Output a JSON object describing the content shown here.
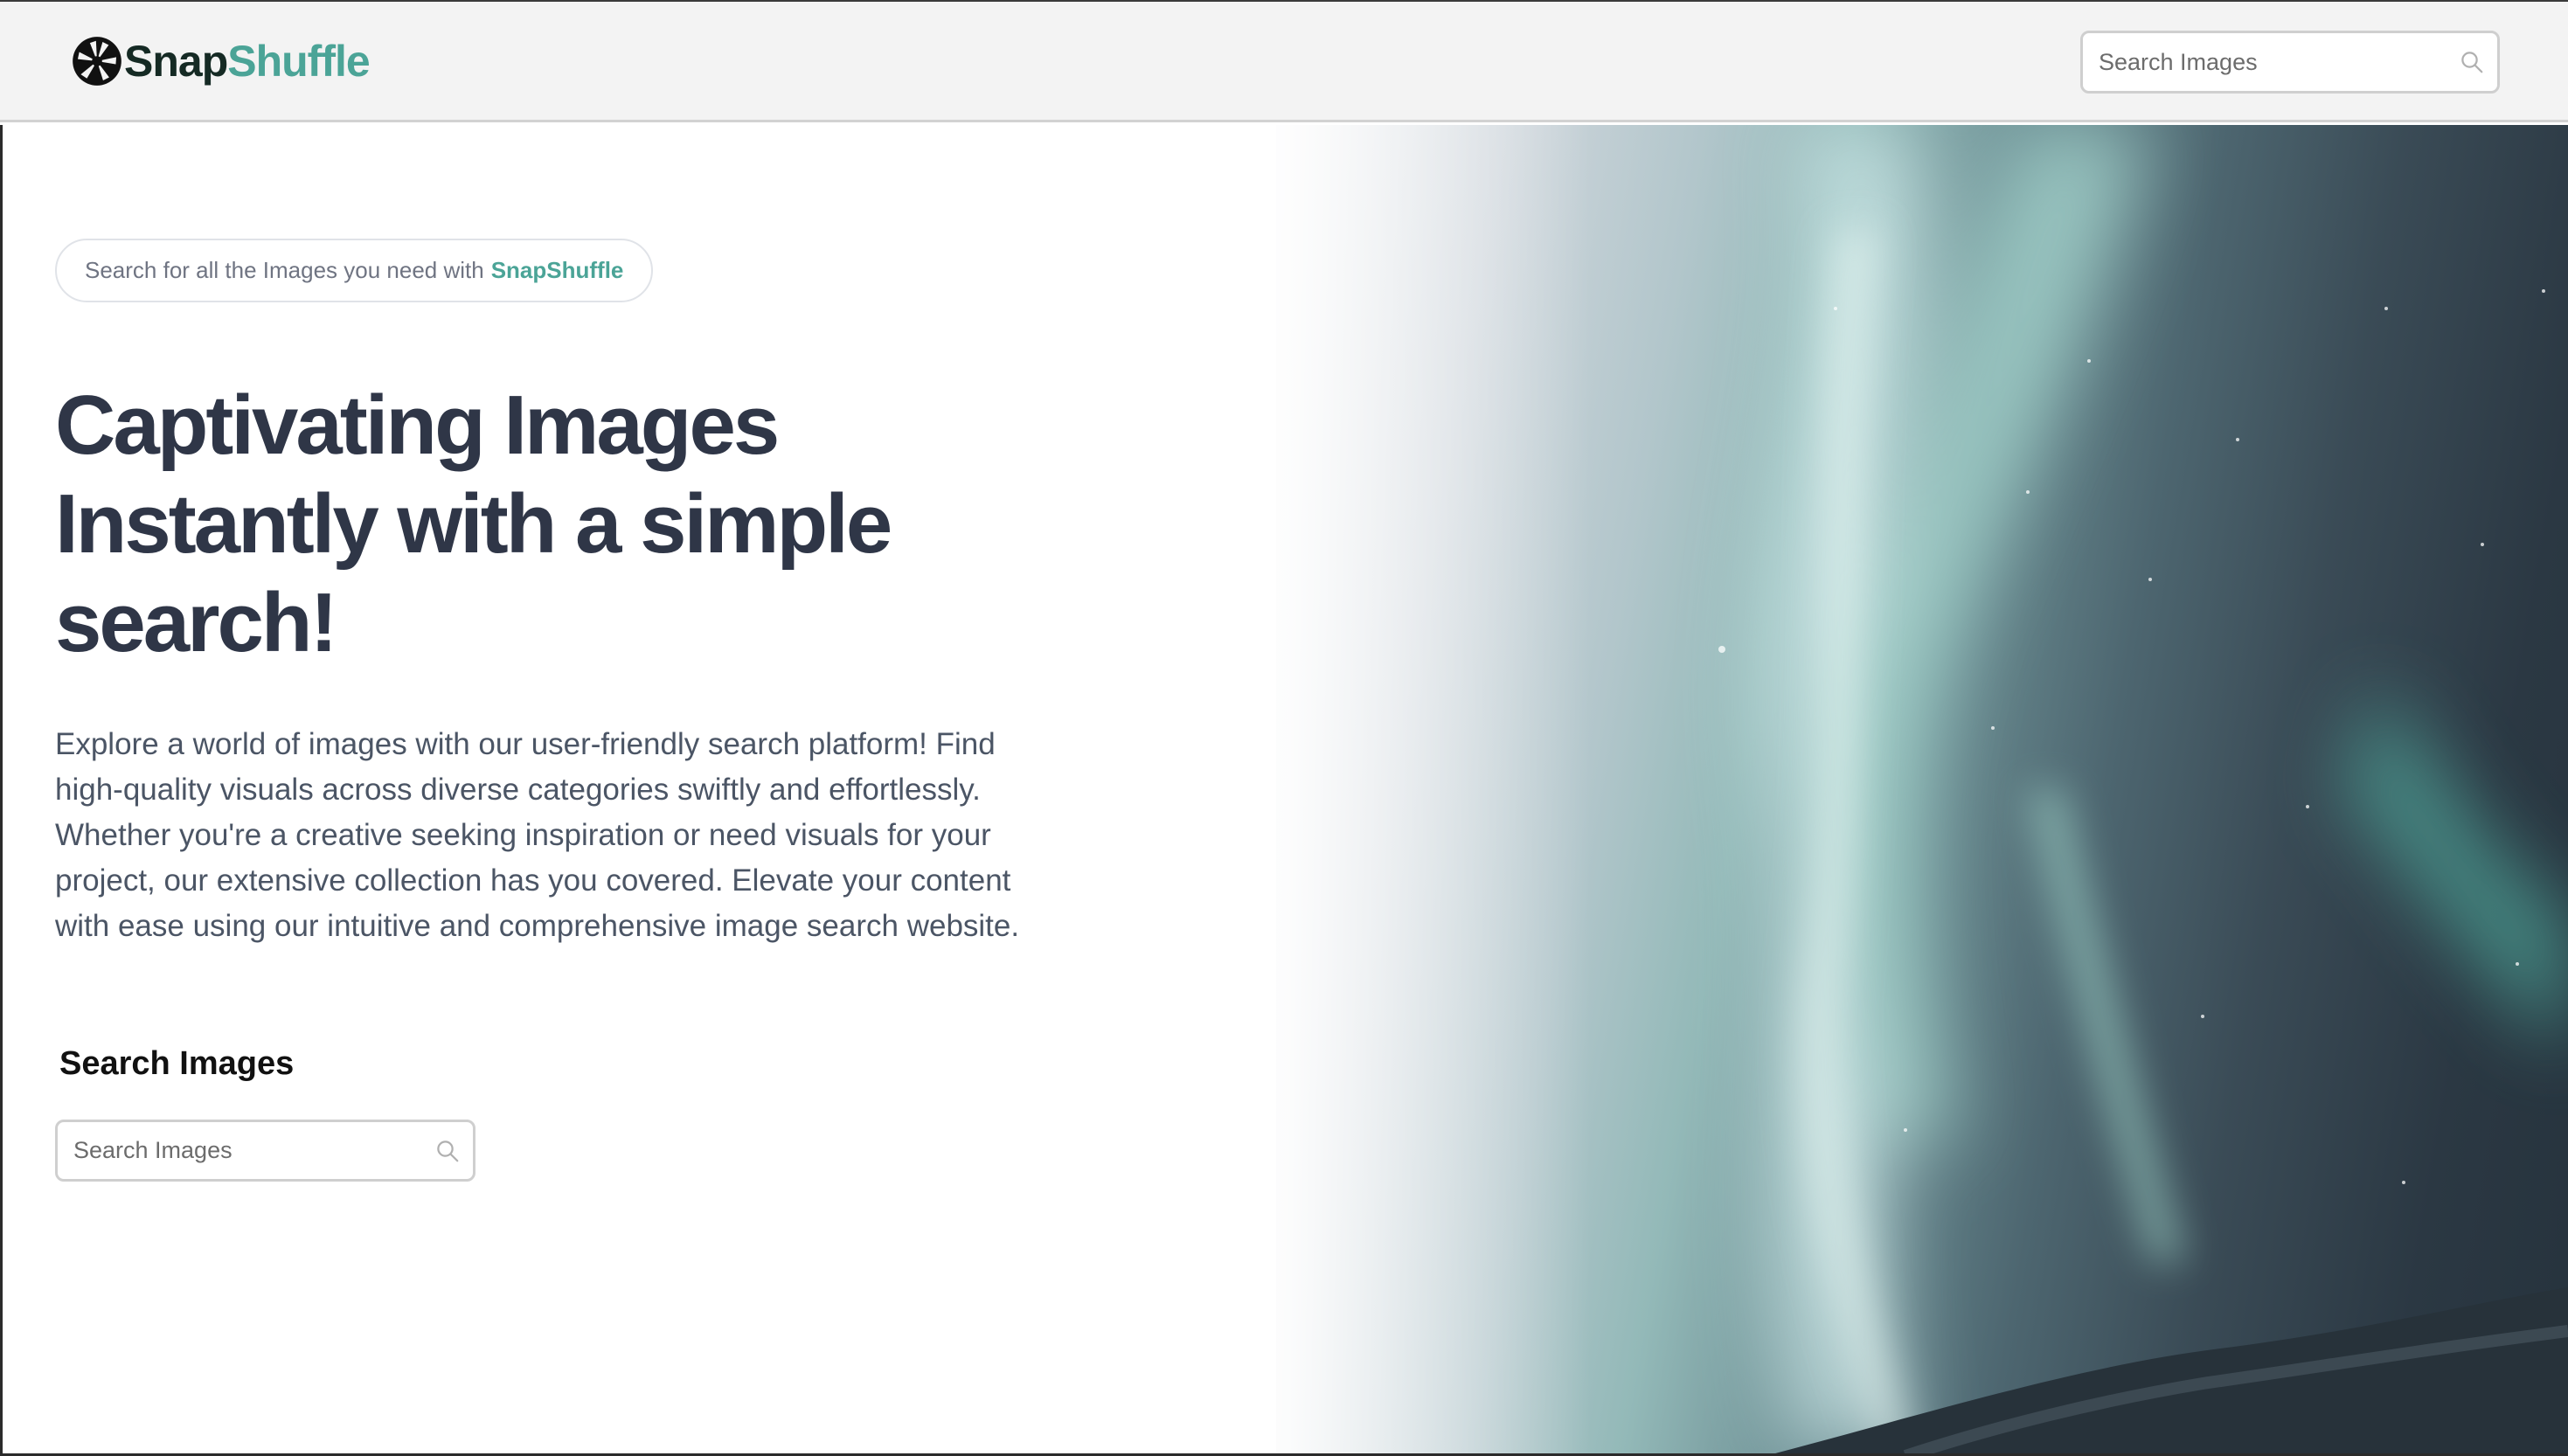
{
  "header": {
    "logo": {
      "icon": "camera-aperture-icon",
      "brand_part1": "Snap",
      "brand_part2": "Shuffle"
    },
    "search": {
      "placeholder": "Search Images",
      "icon": "search-icon"
    }
  },
  "hero": {
    "tagline": {
      "text": "Search for all the Images you need with",
      "brand": "SnapShuffle"
    },
    "headline_lines": [
      "Captivating Images",
      "Instantly with a simple",
      "search!"
    ],
    "description_lines": [
      "Explore a world of images with our user-friendly search platform! Find",
      "high-quality visuals across diverse categories swiftly and effortlessly.",
      "Whether you're a creative seeking inspiration or need visuals for your",
      "project, our extensive collection has you covered. Elevate your content",
      "with ease using our intuitive and comprehensive image search website."
    ],
    "search_section": {
      "title": "Search Images",
      "placeholder": "Search Images",
      "icon": "search-icon"
    },
    "image": {
      "subject": "aurora-night-sky-photo"
    }
  },
  "colors": {
    "brand_dark": "#152a24",
    "brand_accent": "#4ba497",
    "heading": "#2f3647",
    "body_text": "#4b5565",
    "header_bg": "#f3f3f3"
  }
}
